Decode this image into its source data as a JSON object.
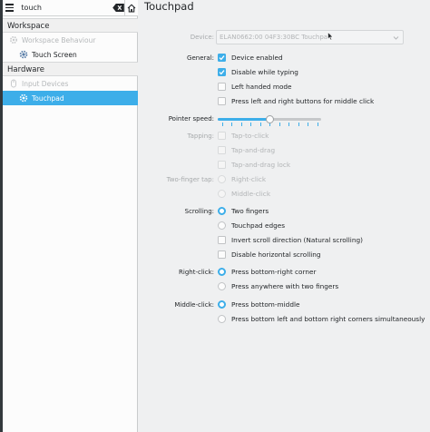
{
  "search": {
    "value": "touch"
  },
  "sidebar": {
    "sections": [
      {
        "header": "Workspace",
        "items": [
          {
            "label": "Workspace Behaviour",
            "dim": true
          },
          {
            "label": "Touch Screen",
            "dim": false
          }
        ]
      },
      {
        "header": "Hardware",
        "items": [
          {
            "label": "Input Devices",
            "dim": true
          },
          {
            "label": "Touchpad",
            "dim": false,
            "selected": true
          }
        ]
      }
    ]
  },
  "main": {
    "title": "Touchpad",
    "device": {
      "label": "Device:",
      "value": "ELAN0662:00 04F3:30BC Touchpad"
    },
    "general": {
      "label": "General:",
      "options": [
        {
          "label": "Device enabled",
          "checked": true
        },
        {
          "label": "Disable while typing",
          "checked": true
        },
        {
          "label": "Left handed mode",
          "checked": false
        },
        {
          "label": "Press left and right buttons for middle click",
          "checked": false
        }
      ]
    },
    "pointer_speed": {
      "label": "Pointer speed:",
      "value_fraction": 0.5
    },
    "tapping": {
      "label": "Tapping:",
      "options": [
        {
          "label": "Tap-to-click"
        },
        {
          "label": "Tap-and-drag"
        },
        {
          "label": "Tap-and-drag lock"
        }
      ]
    },
    "two_finger_tap": {
      "label": "Two-finger tap:",
      "options": [
        {
          "label": "Right-click"
        },
        {
          "label": "Middle-click"
        }
      ]
    },
    "scrolling": {
      "label": "Scrolling:",
      "radios": [
        {
          "label": "Two fingers",
          "selected": true
        },
        {
          "label": "Touchpad edges",
          "selected": false
        }
      ],
      "checks": [
        {
          "label": "Invert scroll direction (Natural scrolling)",
          "checked": false
        },
        {
          "label": "Disable horizontal scrolling",
          "checked": false
        }
      ]
    },
    "right_click": {
      "label": "Right-click:",
      "radios": [
        {
          "label": "Press bottom-right corner",
          "selected": true
        },
        {
          "label": "Press anywhere with two fingers",
          "selected": false
        }
      ]
    },
    "middle_click": {
      "label": "Middle-click:",
      "radios": [
        {
          "label": "Press bottom-middle",
          "selected": true
        },
        {
          "label": "Press bottom left and bottom right corners simultaneously",
          "selected": false
        }
      ]
    }
  },
  "colors": {
    "accent": "#3daee9",
    "window_bg": "#eff0f1",
    "sidebar_bg": "#fcfcfc"
  },
  "icons": {
    "menu": "hamburger-icon",
    "clear": "backspace-clear-icon",
    "home": "home-icon",
    "settings": "gear-icon"
  }
}
